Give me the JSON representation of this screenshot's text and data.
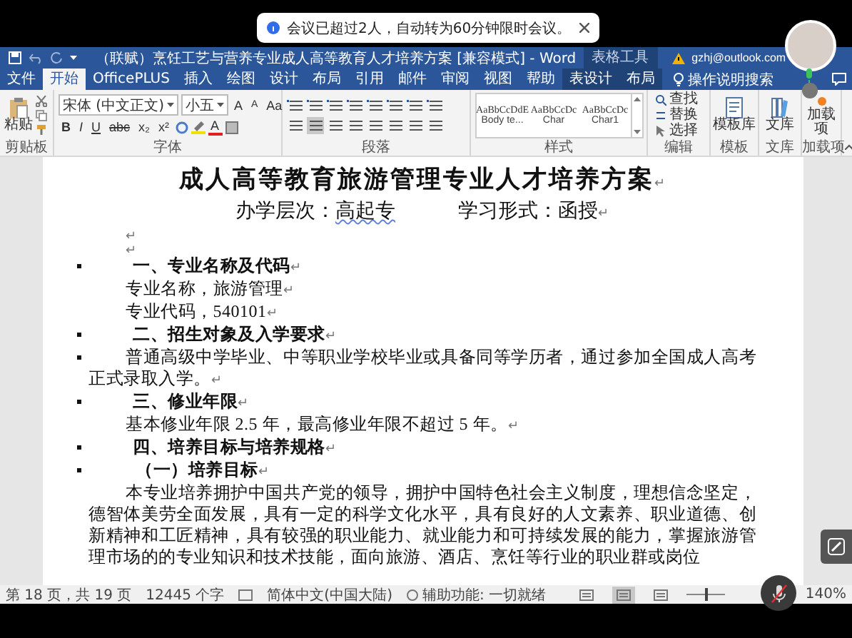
{
  "toast": {
    "message": "会议已超过2人，自动转为60分钟限时会议。"
  },
  "title_bar": {
    "title": "（联赋）烹饪工艺与营养专业成人高等教育人才培养方案 [兼容模式] - Word",
    "context_label": "表格工具",
    "account": "gzhj@outlook.com"
  },
  "tabs": [
    {
      "label": "文件",
      "selected": false,
      "contextual": false
    },
    {
      "label": "开始",
      "selected": true,
      "contextual": false
    },
    {
      "label": "OfficePLUS",
      "selected": false,
      "contextual": false
    },
    {
      "label": "插入",
      "selected": false,
      "contextual": false
    },
    {
      "label": "绘图",
      "selected": false,
      "contextual": false
    },
    {
      "label": "设计",
      "selected": false,
      "contextual": false
    },
    {
      "label": "布局",
      "selected": false,
      "contextual": false
    },
    {
      "label": "引用",
      "selected": false,
      "contextual": false
    },
    {
      "label": "邮件",
      "selected": false,
      "contextual": false
    },
    {
      "label": "审阅",
      "selected": false,
      "contextual": false
    },
    {
      "label": "视图",
      "selected": false,
      "contextual": false
    },
    {
      "label": "帮助",
      "selected": false,
      "contextual": false
    },
    {
      "label": "表设计",
      "selected": false,
      "contextual": true
    },
    {
      "label": "布局",
      "selected": false,
      "contextual": true
    }
  ],
  "tell_me": "操作说明搜索",
  "ribbon": {
    "paste": "粘贴",
    "font_name": "宋体 (中文正文)",
    "font_size": "小五",
    "size_buttons": [
      "A",
      "A",
      "Aa"
    ],
    "format_buttons": [
      "B",
      "I",
      "U",
      "abc",
      "x₂",
      "x²"
    ],
    "font_color_button": "A",
    "styles": [
      {
        "preview": "AaBbCcDdE",
        "name": "Body te..."
      },
      {
        "preview": "AaBbCcDc",
        "name": "Char"
      },
      {
        "preview": "AaBbCcDc",
        "name": "Char1"
      }
    ],
    "editing": [
      "查找",
      "替换",
      "选择"
    ],
    "big_buttons": [
      "模板库",
      "文库",
      "加载项"
    ],
    "group_labels": [
      "剪贴板",
      "字体",
      "段落",
      "样式",
      "编辑",
      "模板",
      "文库",
      "加载项"
    ]
  },
  "document": {
    "title": "成人高等教育旅游管理专业人才培养方案",
    "title_mark": "↵",
    "subtitle": [
      {
        "label": "办学层次：",
        "value": "高起专",
        "flagged": true
      },
      {
        "label": "学习形式：",
        "value": "函授",
        "flagged": false
      }
    ],
    "subtitle_mark": "↵",
    "paragraphs": [
      {
        "kind": "blank",
        "bullet": false,
        "end_mark": "↵"
      },
      {
        "kind": "blank",
        "bullet": false,
        "end_mark": "↵"
      },
      {
        "kind": "heading",
        "bullet": true,
        "text": "一、专业名称及代码",
        "end_mark": "↵"
      },
      {
        "kind": "body",
        "bullet": false,
        "text": "专业名称，旅游管理",
        "end_mark": "↵"
      },
      {
        "kind": "body",
        "bullet": false,
        "text": "专业代码，540101",
        "end_mark": "↵"
      },
      {
        "kind": "heading",
        "bullet": true,
        "text": "二、招生对象及入学要求",
        "end_mark": "↵"
      },
      {
        "kind": "body",
        "bullet": true,
        "text": "普通高级中学毕业、中等职业学校毕业或具备同等学历者，通过参加全国成人高考正式录取入学。",
        "end_mark": "↵"
      },
      {
        "kind": "heading",
        "bullet": true,
        "text": "三、修业年限",
        "end_mark": "↵"
      },
      {
        "kind": "body",
        "bullet": false,
        "text": "基本修业年限 2.5 年，最高修业年限不超过 5 年。",
        "end_mark": "↵"
      },
      {
        "kind": "heading",
        "bullet": true,
        "text": "四、培养目标与培养规格",
        "end_mark": "↵"
      },
      {
        "kind": "subheading",
        "bullet": true,
        "text": "（一）培养目标",
        "end_mark": "↵"
      },
      {
        "kind": "body",
        "bullet": false,
        "text": "本专业培养拥护中国共产党的领导，拥护中国特色社会主义制度，理想信念坚定，德智体美劳全面发展，具有一定的科学文化水平，具有良好的人文素养、职业道德、创新精神和工匠精神，具有较强的职业能力、就业能力和可持续发展的能力，掌握旅游管理市场的的专业知识和技术技能，面向旅游、酒店、烹饪等行业的职业群或岗位"
      }
    ]
  },
  "status_bar": {
    "page": "第 18 页，共 19 页",
    "words": "12445 个字",
    "language": "简体中文(中国大陆)",
    "accessibility": "辅助功能: 一切就绪",
    "views": [
      {
        "selected": false
      },
      {
        "selected": true
      },
      {
        "selected": false
      }
    ],
    "zoom": {
      "level": 0.5,
      "reading": "140%"
    }
  }
}
